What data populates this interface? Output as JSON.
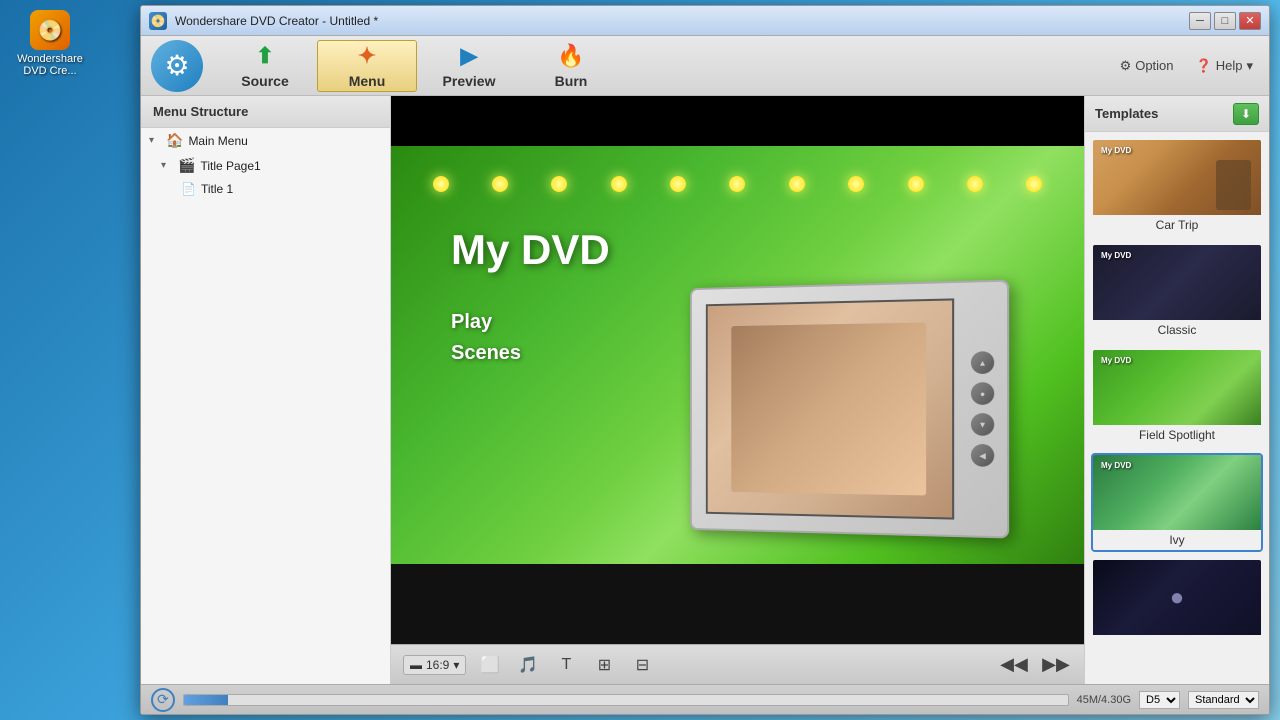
{
  "desktop": {
    "icons": [
      {
        "label": "Wondershare DVD Cre...",
        "icon": "📀"
      }
    ]
  },
  "app": {
    "title": "Wondershare DVD Creator - Untitled *",
    "logo_icon": "⚙",
    "titlebar": {
      "minimize": "─",
      "maximize": "□",
      "close": "✕"
    },
    "toolbar": {
      "source_label": "Source",
      "menu_label": "Menu",
      "preview_label": "Preview",
      "burn_label": "Burn",
      "option_label": "Option",
      "help_label": "Help"
    },
    "left_panel": {
      "header": "Menu Structure",
      "tree": [
        {
          "label": "Main Menu",
          "level": 0,
          "type": "folder",
          "expanded": true
        },
        {
          "label": "Title Page1",
          "level": 1,
          "type": "film",
          "expanded": true
        },
        {
          "label": "Title 1",
          "level": 2,
          "type": "page"
        }
      ]
    },
    "preview": {
      "dvd_title": "My DVD",
      "menu_items": [
        "Play",
        "Scenes"
      ],
      "aspect_ratio": "16:9",
      "lights_count": 11
    },
    "right_panel": {
      "header": "Templates",
      "download_icon": "⬇",
      "templates": [
        {
          "id": "car-trip",
          "label": "Car Trip",
          "selected": false
        },
        {
          "id": "classic",
          "label": "Classic",
          "selected": false
        },
        {
          "id": "field-spotlight",
          "label": "Field Spotlight",
          "selected": false
        },
        {
          "id": "ivy",
          "label": "Ivy",
          "selected": true
        },
        {
          "id": "mystery",
          "label": "",
          "selected": false
        }
      ]
    },
    "status_bar": {
      "size_info": "45M/4.30G",
      "disc_type": "D5",
      "quality": "Standard"
    }
  }
}
